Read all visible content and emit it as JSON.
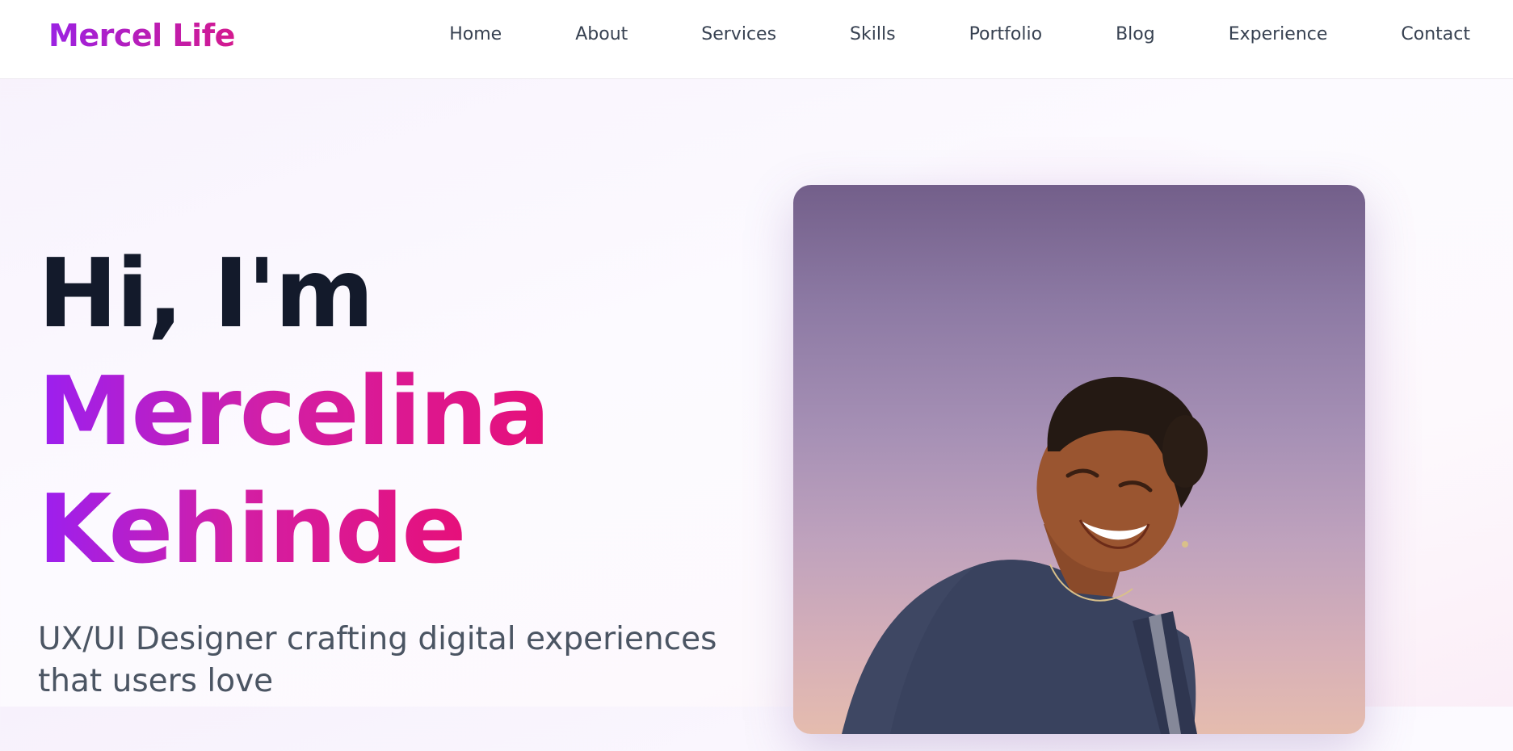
{
  "site": {
    "logo": "Mercel Life"
  },
  "nav": {
    "items": [
      "Home",
      "About",
      "Services",
      "Skills",
      "Portfolio",
      "Blog",
      "Experience",
      "Contact"
    ]
  },
  "hero": {
    "greeting": "Hi, I'm",
    "first_name": "Mercelina",
    "last_name": "Kehinde",
    "tagline": "UX/UI Designer crafting digital experiences that users love"
  },
  "colors": {
    "brand_gradient_start": "#9b1ff0",
    "brand_gradient_end": "#e6107a",
    "heading": "#131a2b",
    "body_text": "#4b5563"
  }
}
